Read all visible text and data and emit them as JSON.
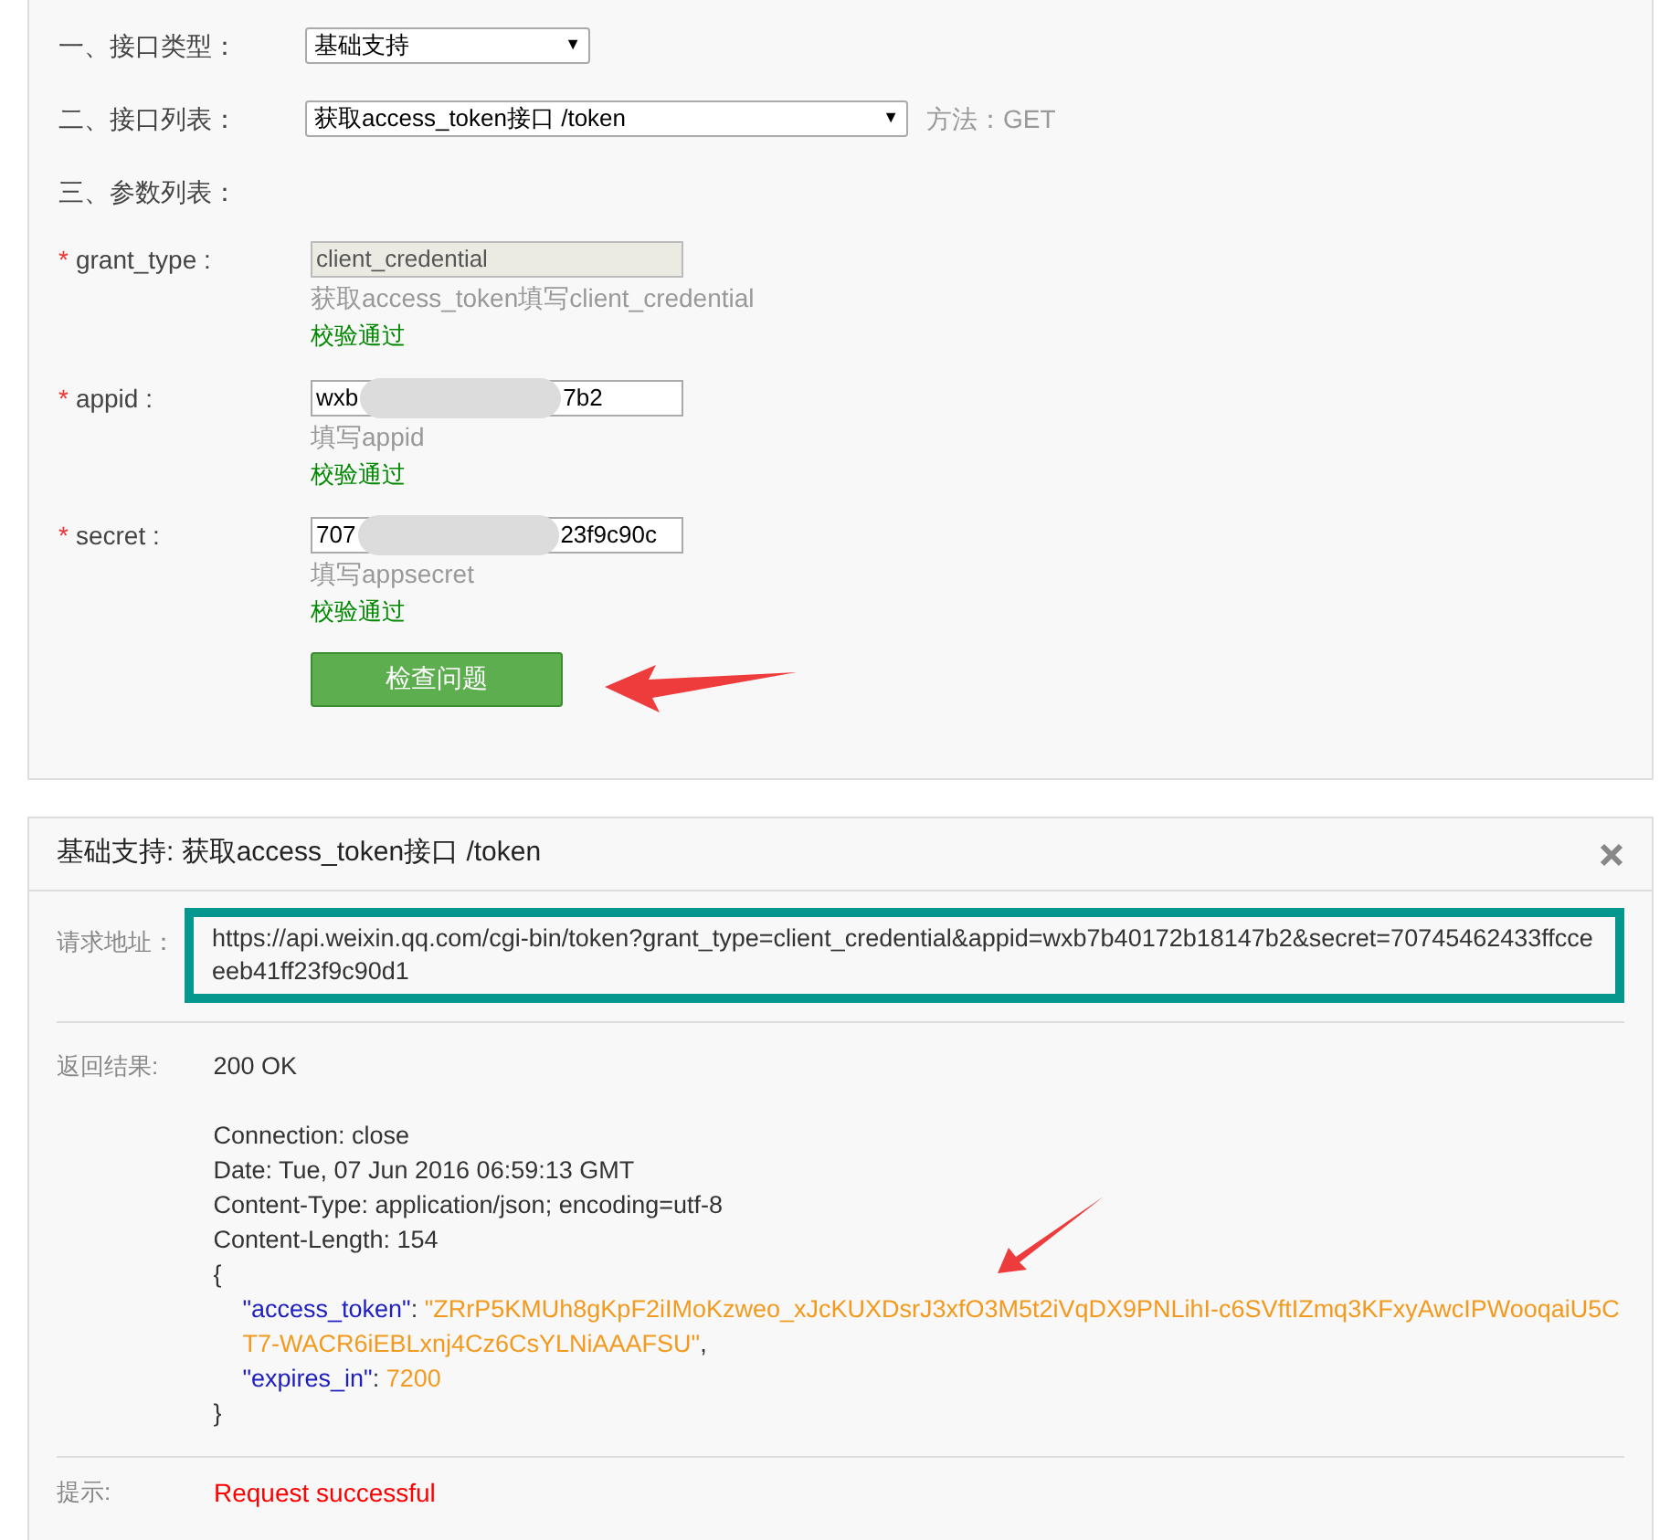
{
  "form": {
    "interface_type": {
      "label": "一、接口类型：",
      "value": "基础支持",
      "caret": "▼"
    },
    "interface_list": {
      "label": "二、接口列表：",
      "value": "获取access_token接口 /token",
      "caret": "▼",
      "method": "方法：GET"
    },
    "required_mark": "*",
    "params_heading": "三、参数列表：",
    "params": [
      {
        "required": true,
        "name": "grant_type :",
        "value_start": "client_credential",
        "disabled": true,
        "hint": "获取access_token填写client_credential",
        "status": "校验通过"
      },
      {
        "required": true,
        "name": "appid :",
        "value_start": "wxb",
        "value_end": "7b2",
        "disabled": false,
        "hint": "填写appid",
        "status": "校验通过"
      },
      {
        "required": true,
        "name": "secret :",
        "value_start": "707",
        "value_end": "23f9c90c",
        "disabled": false,
        "hint": "填写appsecret",
        "status": "校验通过"
      }
    ],
    "submit": "检查问题"
  },
  "result": {
    "title": "基础支持: 获取access_token接口 /token",
    "request_label": "请求地址：",
    "request_url": "https://api.weixin.qq.com/cgi-bin/token?grant_type=client_credential&appid=wxb7b40172b18147b2&secret=70745462433ffcceeeb41ff23f9c90d1",
    "response_label": "返回结果:",
    "status_line": "200 OK",
    "headers": [
      "Connection: close",
      "Date: Tue, 07 Jun 2016 06:59:13 GMT",
      "Content-Type: application/json; encoding=utf-8",
      "Content-Length: 154"
    ],
    "open_brace": "{",
    "fields": [
      {
        "key": "\"access_token\"",
        "sep": ": ",
        "value": "\"ZRrP5KMUh8gKpF2iIMoKzweo_xJcKUXDsrJ3xfO3M5t2iVqDX9PNLihI-c6SVftIZmq3KFxyAwcIPWooqaiU5CT7-WACR6iEBLxnj4Cz6CsYLNiAAAFSU\"",
        "after": ","
      },
      {
        "key": "\"expires_in\"",
        "sep": ": ",
        "value": "7200"
      }
    ],
    "close_brace": "}",
    "hint_label": "提示:",
    "hint": "Request successful"
  }
}
